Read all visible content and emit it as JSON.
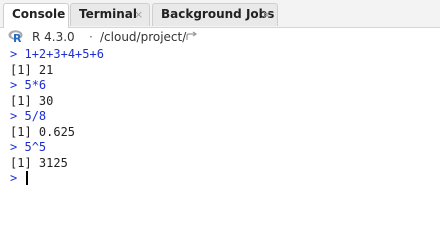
{
  "tabs": [
    {
      "label": "Console",
      "active": true,
      "closable": false
    },
    {
      "label": "Terminal",
      "active": false,
      "closable": true
    },
    {
      "label": "Background Jobs",
      "active": false,
      "closable": true
    }
  ],
  "close_glyph": "×",
  "infobar": {
    "r_logo_letter": "R",
    "version": "R 4.3.0",
    "separator": "·",
    "path": "/cloud/project/",
    "icon": "goto-directory-icon"
  },
  "console": {
    "prompt_symbol": ">",
    "lines": [
      {
        "type": "input",
        "text": "1+2+3+4+5+6"
      },
      {
        "type": "output",
        "text": "[1] 21"
      },
      {
        "type": "input",
        "text": "5*6"
      },
      {
        "type": "output",
        "text": "[1] 30"
      },
      {
        "type": "input",
        "text": "5/8"
      },
      {
        "type": "output",
        "text": "[1] 0.625"
      },
      {
        "type": "input",
        "text": "5^5"
      },
      {
        "type": "output",
        "text": "[1] 3125"
      }
    ],
    "current_input": ""
  },
  "colors": {
    "prompt": "#1c2fd6",
    "output": "#222222",
    "r_logo_blue": "#276dc3",
    "r_logo_grey": "#a8a9ad"
  }
}
